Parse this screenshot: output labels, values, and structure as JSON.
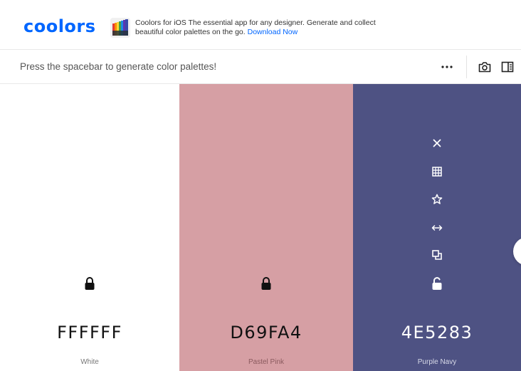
{
  "header": {
    "logo": "coolors",
    "promo": {
      "title": "Coolors for iOS",
      "text": " The essential app for any designer. Generate and collect beautiful color palettes on the go. ",
      "link": "Download Now"
    }
  },
  "toolbar": {
    "hint": "Press the spacebar to generate color palettes!",
    "more_icon": "more-icon",
    "camera_icon": "camera-icon",
    "sidebar_icon": "sidebar-icon"
  },
  "palette": {
    "colors": [
      {
        "hex": "FFFFFF",
        "name": "White",
        "bg": "#FFFFFF",
        "fg": "#111111",
        "sub": "#777777"
      },
      {
        "hex": "D69FA4",
        "name": "Pastel Pink",
        "bg": "#D69FA4",
        "fg": "#111111",
        "sub": "#8a5a5e"
      },
      {
        "hex": "4E5283",
        "name": "Purple Navy",
        "bg": "#4E5283",
        "fg": "#FFFFFF",
        "sub": "#d8dae8"
      }
    ],
    "tools": [
      "close-icon",
      "grid-icon",
      "star-icon",
      "drag-icon",
      "copy-icon",
      "unlock-icon"
    ]
  },
  "colors": {
    "brand": "#0066ff"
  }
}
